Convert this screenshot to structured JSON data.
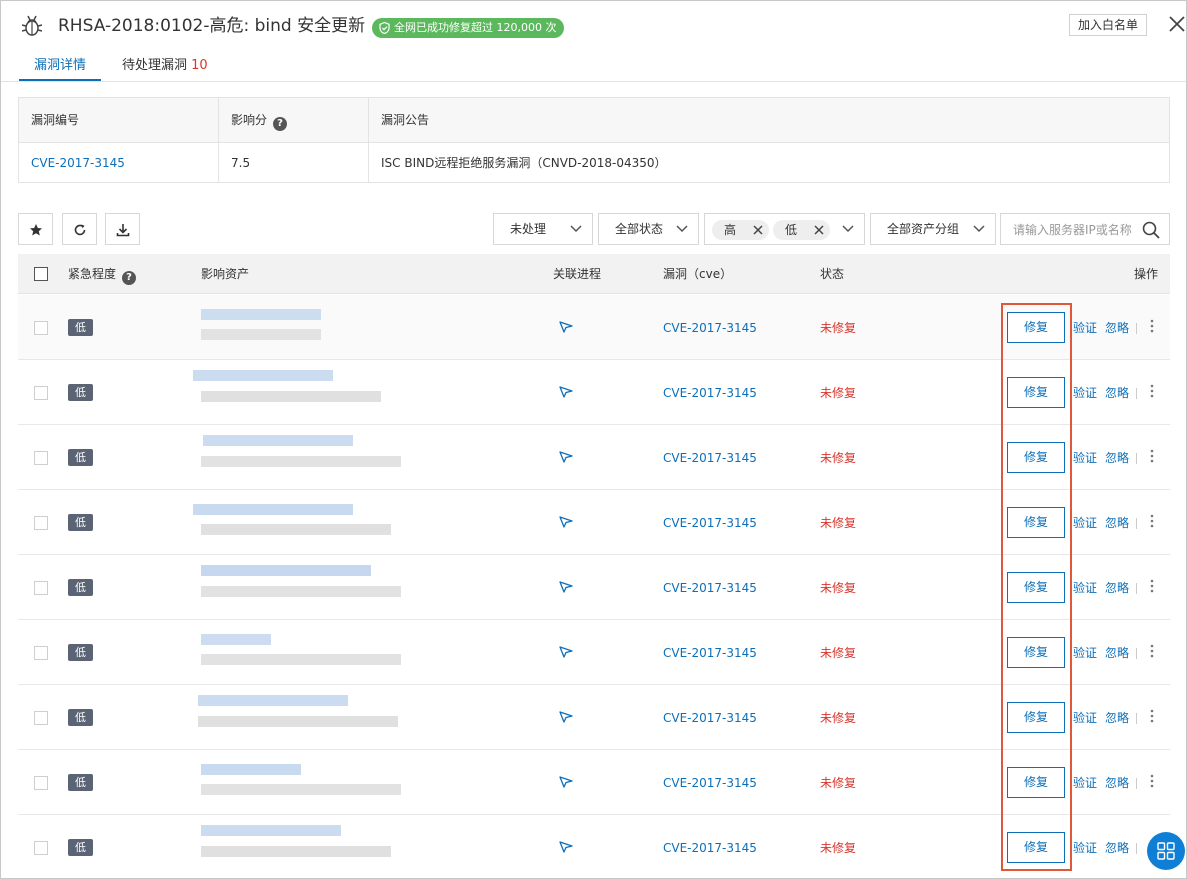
{
  "header": {
    "title": "RHSA-2018:0102-高危: bind 安全更新",
    "badge": "全网已成功修复超过 120,000 次",
    "whitelist_button": "加入白名单",
    "icons": {
      "bug": "bug-icon",
      "close": "close-icon",
      "badge": "shield-check-icon"
    }
  },
  "tabs": [
    {
      "label": "漏洞详情",
      "active": true
    },
    {
      "label": "待处理漏洞",
      "count": "10",
      "active": false
    }
  ],
  "info": {
    "headers": {
      "id": "漏洞编号",
      "score": "影响分",
      "notice": "漏洞公告"
    },
    "values": {
      "id": "CVE-2017-3145",
      "score": "7.5",
      "notice": "ISC BIND远程拒绝服务漏洞（CNVD-2018-04350）"
    }
  },
  "toolbar": {
    "icon_buttons": [
      "star-icon",
      "refresh-icon",
      "download-icon"
    ],
    "filter_status_handled": "未处理",
    "filter_status_all": "全部状态",
    "severity_tags": [
      "高",
      "低"
    ],
    "filter_asset_group": "全部资产分组",
    "search_placeholder": "请输入服务器IP或名称"
  },
  "table": {
    "headers": {
      "urgency": "紧急程度",
      "asset": "影响资产",
      "process": "关联进程",
      "cve": "漏洞（cve）",
      "status": "状态",
      "actions": "操作"
    },
    "row_common": {
      "urgency": "低",
      "cve": "CVE-2017-3145",
      "status": "未修复",
      "fix": "修复",
      "verify": "验证",
      "ignore": "忽略"
    },
    "rows": [
      {
        "urgency": "低",
        "cve": "CVE-2017-3145",
        "status": "未修复",
        "fix": "修复",
        "verify": "验证",
        "ignore": "忽略"
      },
      {
        "urgency": "低",
        "cve": "CVE-2017-3145",
        "status": "未修复",
        "fix": "修复",
        "verify": "验证",
        "ignore": "忽略"
      },
      {
        "urgency": "低",
        "cve": "CVE-2017-3145",
        "status": "未修复",
        "fix": "修复",
        "verify": "验证",
        "ignore": "忽略"
      },
      {
        "urgency": "低",
        "cve": "CVE-2017-3145",
        "status": "未修复",
        "fix": "修复",
        "verify": "验证",
        "ignore": "忽略"
      },
      {
        "urgency": "低",
        "cve": "CVE-2017-3145",
        "status": "未修复",
        "fix": "修复",
        "verify": "验证",
        "ignore": "忽略"
      },
      {
        "urgency": "低",
        "cve": "CVE-2017-3145",
        "status": "未修复",
        "fix": "修复",
        "verify": "验证",
        "ignore": "忽略"
      },
      {
        "urgency": "低",
        "cve": "CVE-2017-3145",
        "status": "未修复",
        "fix": "修复",
        "verify": "验证",
        "ignore": "忽略"
      },
      {
        "urgency": "低",
        "cve": "CVE-2017-3145",
        "status": "未修复",
        "fix": "修复",
        "verify": "验证",
        "ignore": "忽略"
      },
      {
        "urgency": "低",
        "cve": "CVE-2017-3145",
        "status": "未修复",
        "fix": "修复",
        "verify": "验证",
        "ignore": "忽略"
      }
    ]
  },
  "colors": {
    "link": "#0d6fb8",
    "danger": "#d9342b",
    "success": "#5cb85c",
    "highlight": "#e0573a",
    "badge_low": "#5a6474"
  }
}
